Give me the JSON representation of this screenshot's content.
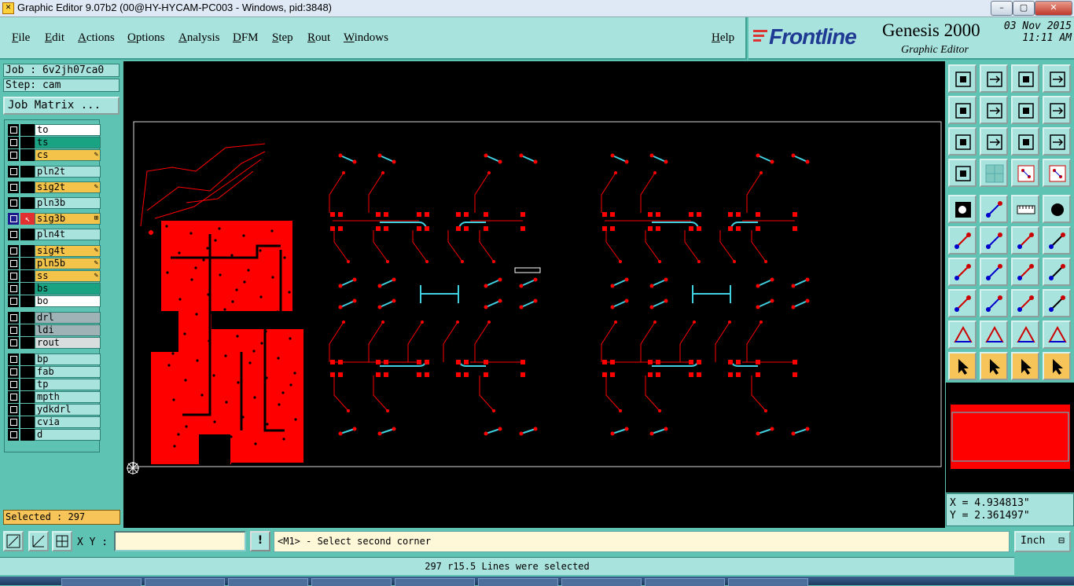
{
  "window": {
    "title": "Graphic Editor 9.07b2 (00@HY-HYCAM-PC003 - Windows, pid:3848)",
    "minimize": "–",
    "maximize": "▢",
    "close": "✕"
  },
  "menu": [
    "File",
    "Edit",
    "Actions",
    "Options",
    "Analysis",
    "DFM",
    "Step",
    "Rout",
    "Windows"
  ],
  "help_label": "Help",
  "brand": {
    "logo": "Frontline",
    "product": "Genesis 2000",
    "subtitle": "Graphic Editor",
    "date": "03 Nov 2015",
    "time": "11:11 AM"
  },
  "job": {
    "job_label": "Job : 6v2jh07ca0",
    "step_label": "Step: cam",
    "matrix_button": "Job Matrix ..."
  },
  "colors": {
    "board": "#ff0000",
    "trace": "#ff0000",
    "highlight": "#40d0e0",
    "canvas": "#000000",
    "panel": "#a9e3dd"
  },
  "layers": [
    {
      "name": "to",
      "color": "#ffffff",
      "lock": false,
      "active": false
    },
    {
      "name": "ts",
      "color": "#1aa383",
      "lock": false,
      "active": false
    },
    {
      "name": "cs",
      "color": "#f3c34a",
      "lock": true,
      "active": false
    },
    {
      "name": "pln2t",
      "color": "#a9e3dd",
      "lock": false,
      "active": false
    },
    {
      "name": "sig2t",
      "color": "#f3c34a",
      "lock": true,
      "active": false
    },
    {
      "name": "pln3b",
      "color": "#a9e3dd",
      "lock": false,
      "active": false
    },
    {
      "name": "sig3b",
      "color": "#f3c34a",
      "lock": true,
      "active": true
    },
    {
      "name": "pln4t",
      "color": "#a9e3dd",
      "lock": false,
      "active": false
    },
    {
      "name": "sig4t",
      "color": "#f3c34a",
      "lock": true,
      "active": false
    },
    {
      "name": "pln5b",
      "color": "#f3c34a",
      "lock": true,
      "active": false
    },
    {
      "name": "ss",
      "color": "#f3c34a",
      "lock": true,
      "active": false
    },
    {
      "name": "bs",
      "color": "#1aa383",
      "lock": false,
      "active": false
    },
    {
      "name": "bo",
      "color": "#ffffff",
      "lock": false,
      "active": false
    },
    {
      "name": "drl",
      "color": "#9fb3b7",
      "lock": false,
      "active": false
    },
    {
      "name": "ldi",
      "color": "#9fb3b7",
      "lock": false,
      "active": false
    },
    {
      "name": "rout",
      "color": "#d9dddd",
      "lock": false,
      "active": false
    },
    {
      "name": "bp",
      "color": "#a9e3dd",
      "lock": false,
      "active": false
    },
    {
      "name": "fab",
      "color": "#a9e3dd",
      "lock": false,
      "active": false
    },
    {
      "name": "tp",
      "color": "#a9e3dd",
      "lock": false,
      "active": false
    },
    {
      "name": "mpth",
      "color": "#a9e3dd",
      "lock": false,
      "active": false
    },
    {
      "name": "ydkdrl",
      "color": "#a9e3dd",
      "lock": false,
      "active": false
    },
    {
      "name": "cvia",
      "color": "#a9e3dd",
      "lock": false,
      "active": false
    },
    {
      "name": "d",
      "color": "#a9e3dd",
      "lock": false,
      "active": false
    }
  ],
  "selected": "Selected : 297",
  "coords": {
    "x": "X = 4.934813\"",
    "y": "Y = 2.361497\""
  },
  "bottom": {
    "xy_label": "X Y :",
    "xy_value": "",
    "warn": "!",
    "prompt": "<M1> - Select second corner",
    "units": "Inch",
    "status": "297 r15.5 Lines were selected"
  },
  "tool_icons": [
    "zoom-home-icon",
    "zoom-back-icon",
    "home-icon",
    "window-icon",
    "pan-left-icon",
    "pan-right-icon",
    "undo-view-icon",
    "redraw-icon",
    "fit-all-icon",
    "center-icon",
    "one-to-two-icon",
    "help-icon",
    "measure-icon",
    "grid-icon",
    "snap-icon",
    "snap-profile-icon",
    "pad-icon",
    "add-shape-icon",
    "ruler-icon",
    "circle-icon",
    "connect-icon",
    "cross-icon",
    "node-icon",
    "arrow-node-icon",
    "angle-icon",
    "line-icon",
    "arc-icon",
    "feature-icon",
    "select-icon",
    "move-icon",
    "attribute-icon",
    "net-icon",
    "drc-icon",
    "triangle-icon",
    "polygon-icon",
    "split-icon",
    "pointer-icon",
    "select-pointer-icon",
    "clock-pointer-icon",
    "route-pointer-icon"
  ]
}
